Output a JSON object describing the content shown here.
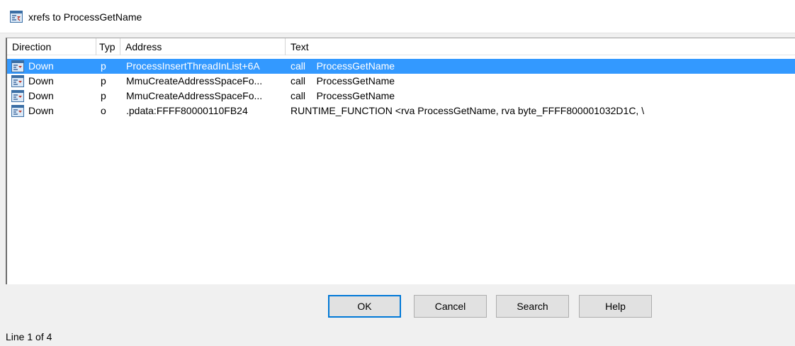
{
  "window": {
    "title": "xrefs to ProcessGetName",
    "icon": "xref-window-icon"
  },
  "columns": [
    "Direction",
    "Typ",
    "Address",
    "Text"
  ],
  "rows": [
    {
      "direction": "Down",
      "type": "p",
      "address": "ProcessInsertThreadInList+6A",
      "text": "call    ProcessGetName",
      "selected": true
    },
    {
      "direction": "Down",
      "type": "p",
      "address": "MmuCreateAddressSpaceFo...",
      "text": "call    ProcessGetName",
      "selected": false
    },
    {
      "direction": "Down",
      "type": "p",
      "address": "MmuCreateAddressSpaceFo...",
      "text": "call    ProcessGetName",
      "selected": false
    },
    {
      "direction": "Down",
      "type": "o",
      "address": ".pdata:FFFF80000110FB24",
      "text": "RUNTIME_FUNCTION <rva ProcessGetName, rva byte_FFFF800001032D1C, \\",
      "selected": false
    }
  ],
  "buttons": {
    "ok": "OK",
    "cancel": "Cancel",
    "search": "Search",
    "help": "Help"
  },
  "status": "Line 1 of 4",
  "colors": {
    "selection": "#3399ff",
    "default_button_border": "#0078d7"
  }
}
